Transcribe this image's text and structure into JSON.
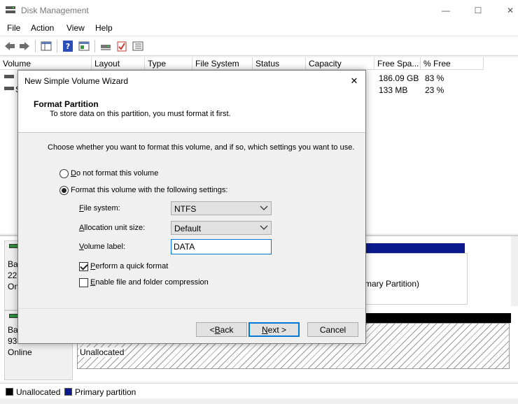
{
  "window": {
    "title": "Disk Management",
    "minimize_glyph": "—",
    "maximize_glyph": "☐",
    "close_glyph": "✕"
  },
  "menu": [
    "File",
    "Action",
    "View",
    "Help"
  ],
  "toolbar": {
    "icons": [
      "back-arrow-icon",
      "forward-arrow-icon",
      "show-hide-console-tree-icon",
      "help-icon",
      "properties-icon",
      "connect-disk-icon",
      "check-icon",
      "list-view-icon"
    ]
  },
  "volume_list": {
    "columns": [
      "Volume",
      "Layout",
      "Type",
      "File System",
      "Status",
      "Capacity",
      "Free Spa...",
      "% Free"
    ],
    "visible_row_fragments": {
      "row2_volume_initial": "S"
    },
    "rows": [
      {
        "free_space": "186.09 GB",
        "percent_free": "83 %"
      },
      {
        "free_space": "133 MB",
        "percent_free": "23 %"
      }
    ]
  },
  "disks": [
    {
      "label_line1": "Ba",
      "label_line2": "22",
      "label_line3": "On",
      "partition_text": "mary Partition)"
    },
    {
      "label_line1": "Ba",
      "label_line2": "93",
      "label_line3": "Online",
      "partition_text": "Unallocated"
    }
  ],
  "legend": {
    "items": [
      {
        "label": "Unallocated",
        "color": "#000000"
      },
      {
        "label": "Primary partition",
        "color": "#0a1a8c"
      }
    ]
  },
  "wizard": {
    "title": "New Simple Volume Wizard",
    "close_glyph": "✕",
    "header_title": "Format Partition",
    "header_subtitle": "To store data on this partition, you must format it first.",
    "intro": "Choose whether you want to format this volume, and if so, which settings you want to use.",
    "option_no_format": {
      "mnemonic": "D",
      "rest": "o not format this volume",
      "selected": false
    },
    "option_format": {
      "mnemonic": "",
      "rest": "Format this volume with the following settings:",
      "selected": true
    },
    "file_system": {
      "mnemonic": "F",
      "rest": "ile system:",
      "value": "NTFS"
    },
    "allocation_unit": {
      "mnemonic": "A",
      "rest": "llocation unit size:",
      "value": "Default"
    },
    "volume_label": {
      "mnemonic": "V",
      "rest": "olume label:",
      "value": "DATA"
    },
    "quick_format": {
      "mnemonic": "P",
      "rest": "erform a quick format",
      "checked": true
    },
    "compression": {
      "mnemonic": "E",
      "rest": "nable file and folder compression",
      "checked": false
    },
    "buttons": {
      "back": {
        "prefix": "< ",
        "mnemonic": "B",
        "rest": "ack"
      },
      "next": {
        "mnemonic": "N",
        "rest": "ext >"
      },
      "cancel": "Cancel"
    }
  }
}
